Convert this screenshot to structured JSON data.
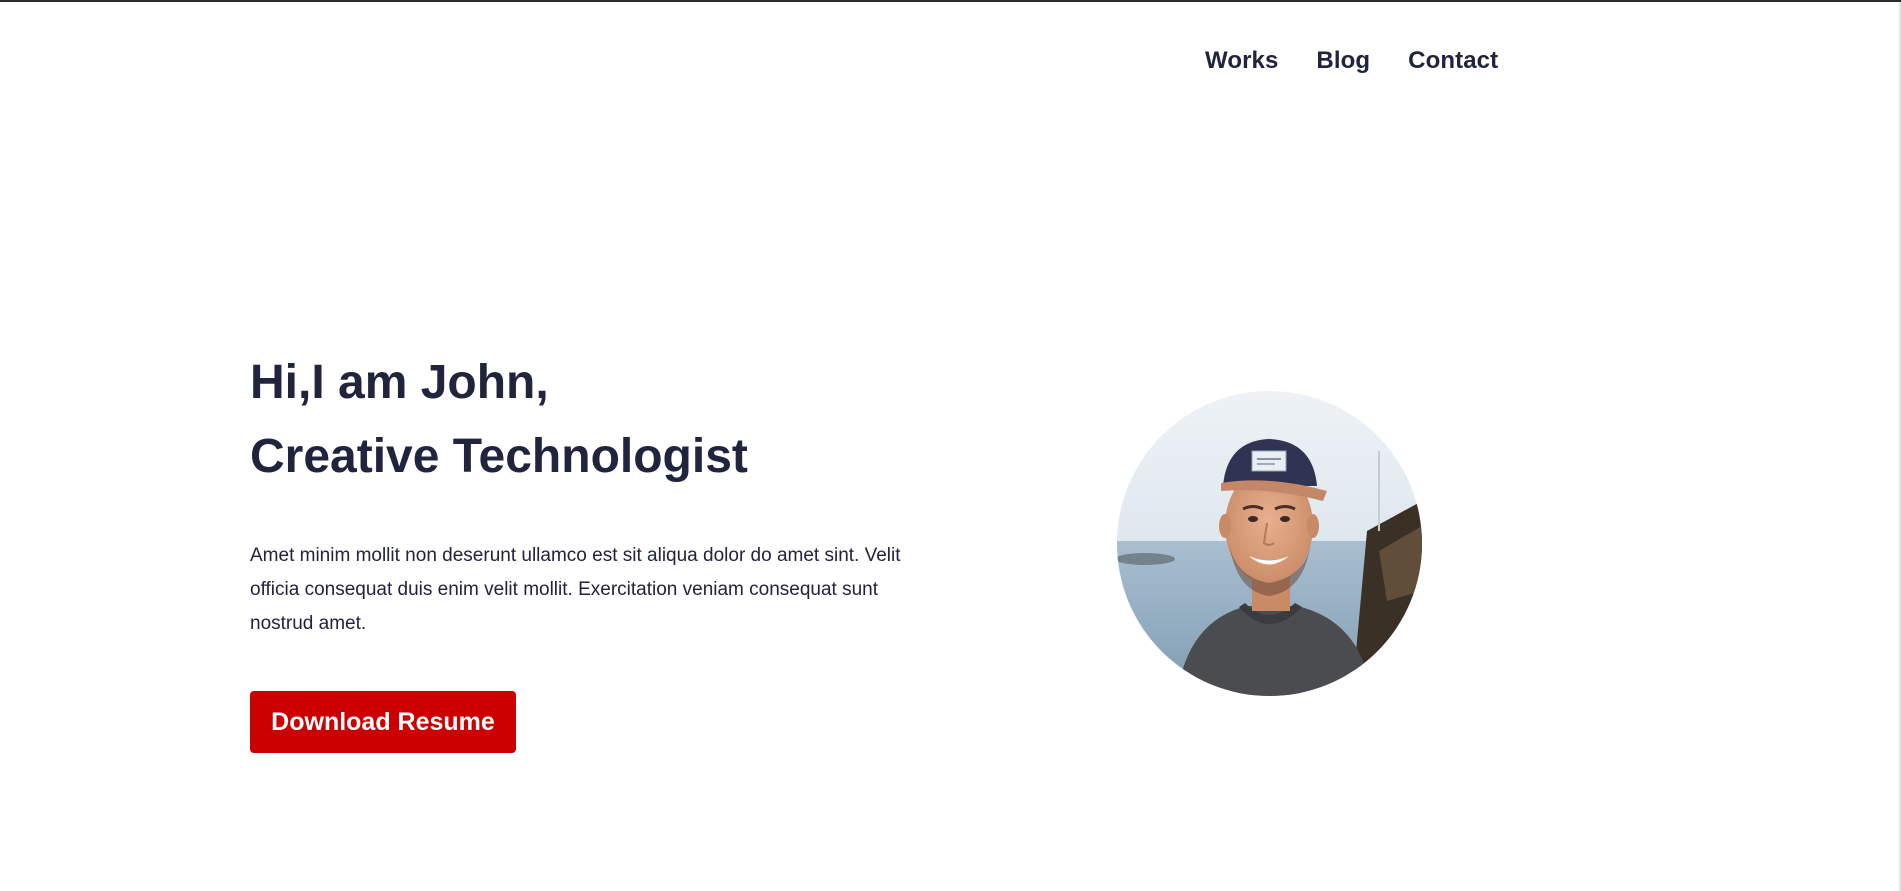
{
  "nav": {
    "items": [
      {
        "label": "Works"
      },
      {
        "label": "Blog"
      },
      {
        "label": "Contact"
      }
    ]
  },
  "hero": {
    "greeting": "Hi,I am John,",
    "role": "Creative Technologist",
    "description": "Amet minim mollit non deserunt ullamco est sit aliqua dolor do amet sint. Velit officia consequat duis enim velit mollit. Exercitation veniam consequat sunt nostrud amet.",
    "cta_label": "Download Resume"
  },
  "colors": {
    "accent": "#cc0000",
    "text": "#21243d",
    "background": "#ffffff"
  },
  "icons": {
    "avatar": "profile-photo"
  }
}
